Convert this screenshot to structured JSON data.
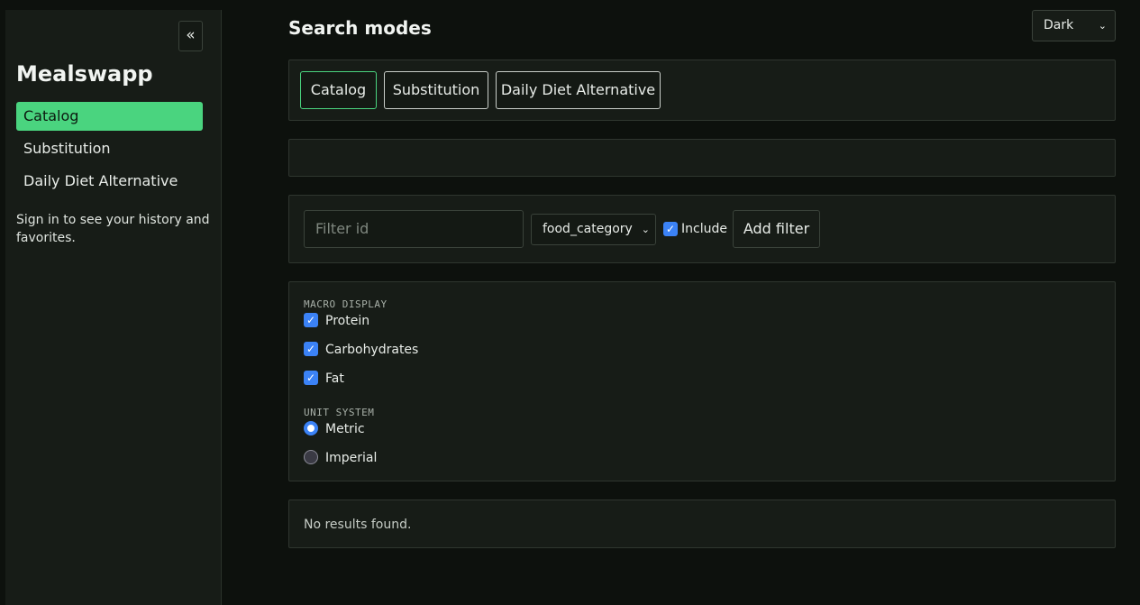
{
  "sidebar": {
    "collapse_glyph": "«",
    "brand": "Mealswapp",
    "items": [
      {
        "label": "Catalog",
        "active": true
      },
      {
        "label": "Substitution",
        "active": false
      },
      {
        "label": "Daily Diet Alternative",
        "active": false
      }
    ],
    "signin_note": "Sign in to see your history and favorites."
  },
  "header": {
    "title": "Search modes",
    "theme": {
      "selected": "Dark"
    }
  },
  "modes": [
    {
      "label": "Catalog",
      "active": true
    },
    {
      "label": "Substitution",
      "active": false
    },
    {
      "label": "Daily Diet Alternative",
      "active": false
    }
  ],
  "search": {
    "value": ""
  },
  "filter": {
    "id_placeholder": "Filter id",
    "field_selected": "food_category",
    "include_label": "Include",
    "include_checked": true,
    "add_label": "Add filter"
  },
  "macro": {
    "section_label": "MACRO DISPLAY",
    "options": [
      {
        "label": "Protein",
        "checked": true
      },
      {
        "label": "Carbohydrates",
        "checked": true
      },
      {
        "label": "Fat",
        "checked": true
      }
    ]
  },
  "units": {
    "section_label": "UNIT SYSTEM",
    "options": [
      {
        "label": "Metric",
        "selected": true
      },
      {
        "label": "Imperial",
        "selected": false
      }
    ]
  },
  "results": {
    "empty_text": "No results found."
  },
  "colors": {
    "accent": "#4ad47f",
    "checkbox": "#3b82f6",
    "background": "#0d110d",
    "panel": "#171c17"
  }
}
